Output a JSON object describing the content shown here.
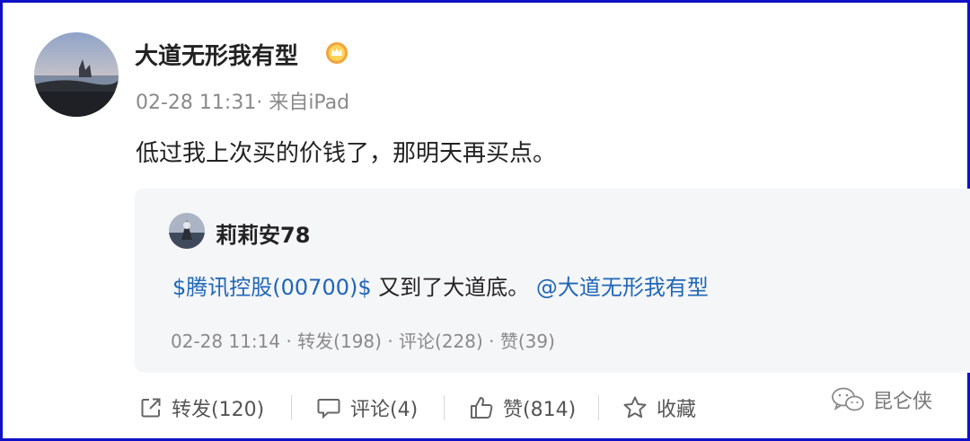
{
  "post": {
    "username": "大道无形我有型",
    "timestamp": "02-28 11:31",
    "source": "· 来自iPad",
    "text": "低过我上次买的价钱了，那明天再买点。"
  },
  "quoted": {
    "username": "莉莉安78",
    "stock_tag": "$腾讯控股(00700)$",
    "text": " 又到了大道底。 ",
    "mention": "@大道无形我有型",
    "timestamp": "02-28 11:14",
    "stats": " · 转发(198) · 评论(228) · 赞(39)"
  },
  "actions": {
    "repost_label": "转发(120)",
    "comment_label": "评论(4)",
    "like_label": "赞(814)",
    "favorite_label": "收藏"
  },
  "watermark": {
    "text": "昆仑侠"
  },
  "icons": {
    "repost": "share-arrow-icon",
    "comment": "speech-bubble-icon",
    "like": "thumbs-up-icon",
    "favorite": "star-outline-icon",
    "vip": "vip-crown-badge-icon",
    "watermark": "wechat-icon"
  },
  "colors": {
    "frame_border": "#1010c8",
    "link": "#1f66b8",
    "quote_background": "#f5f6f8",
    "vip_badge": "#f3a43a"
  }
}
